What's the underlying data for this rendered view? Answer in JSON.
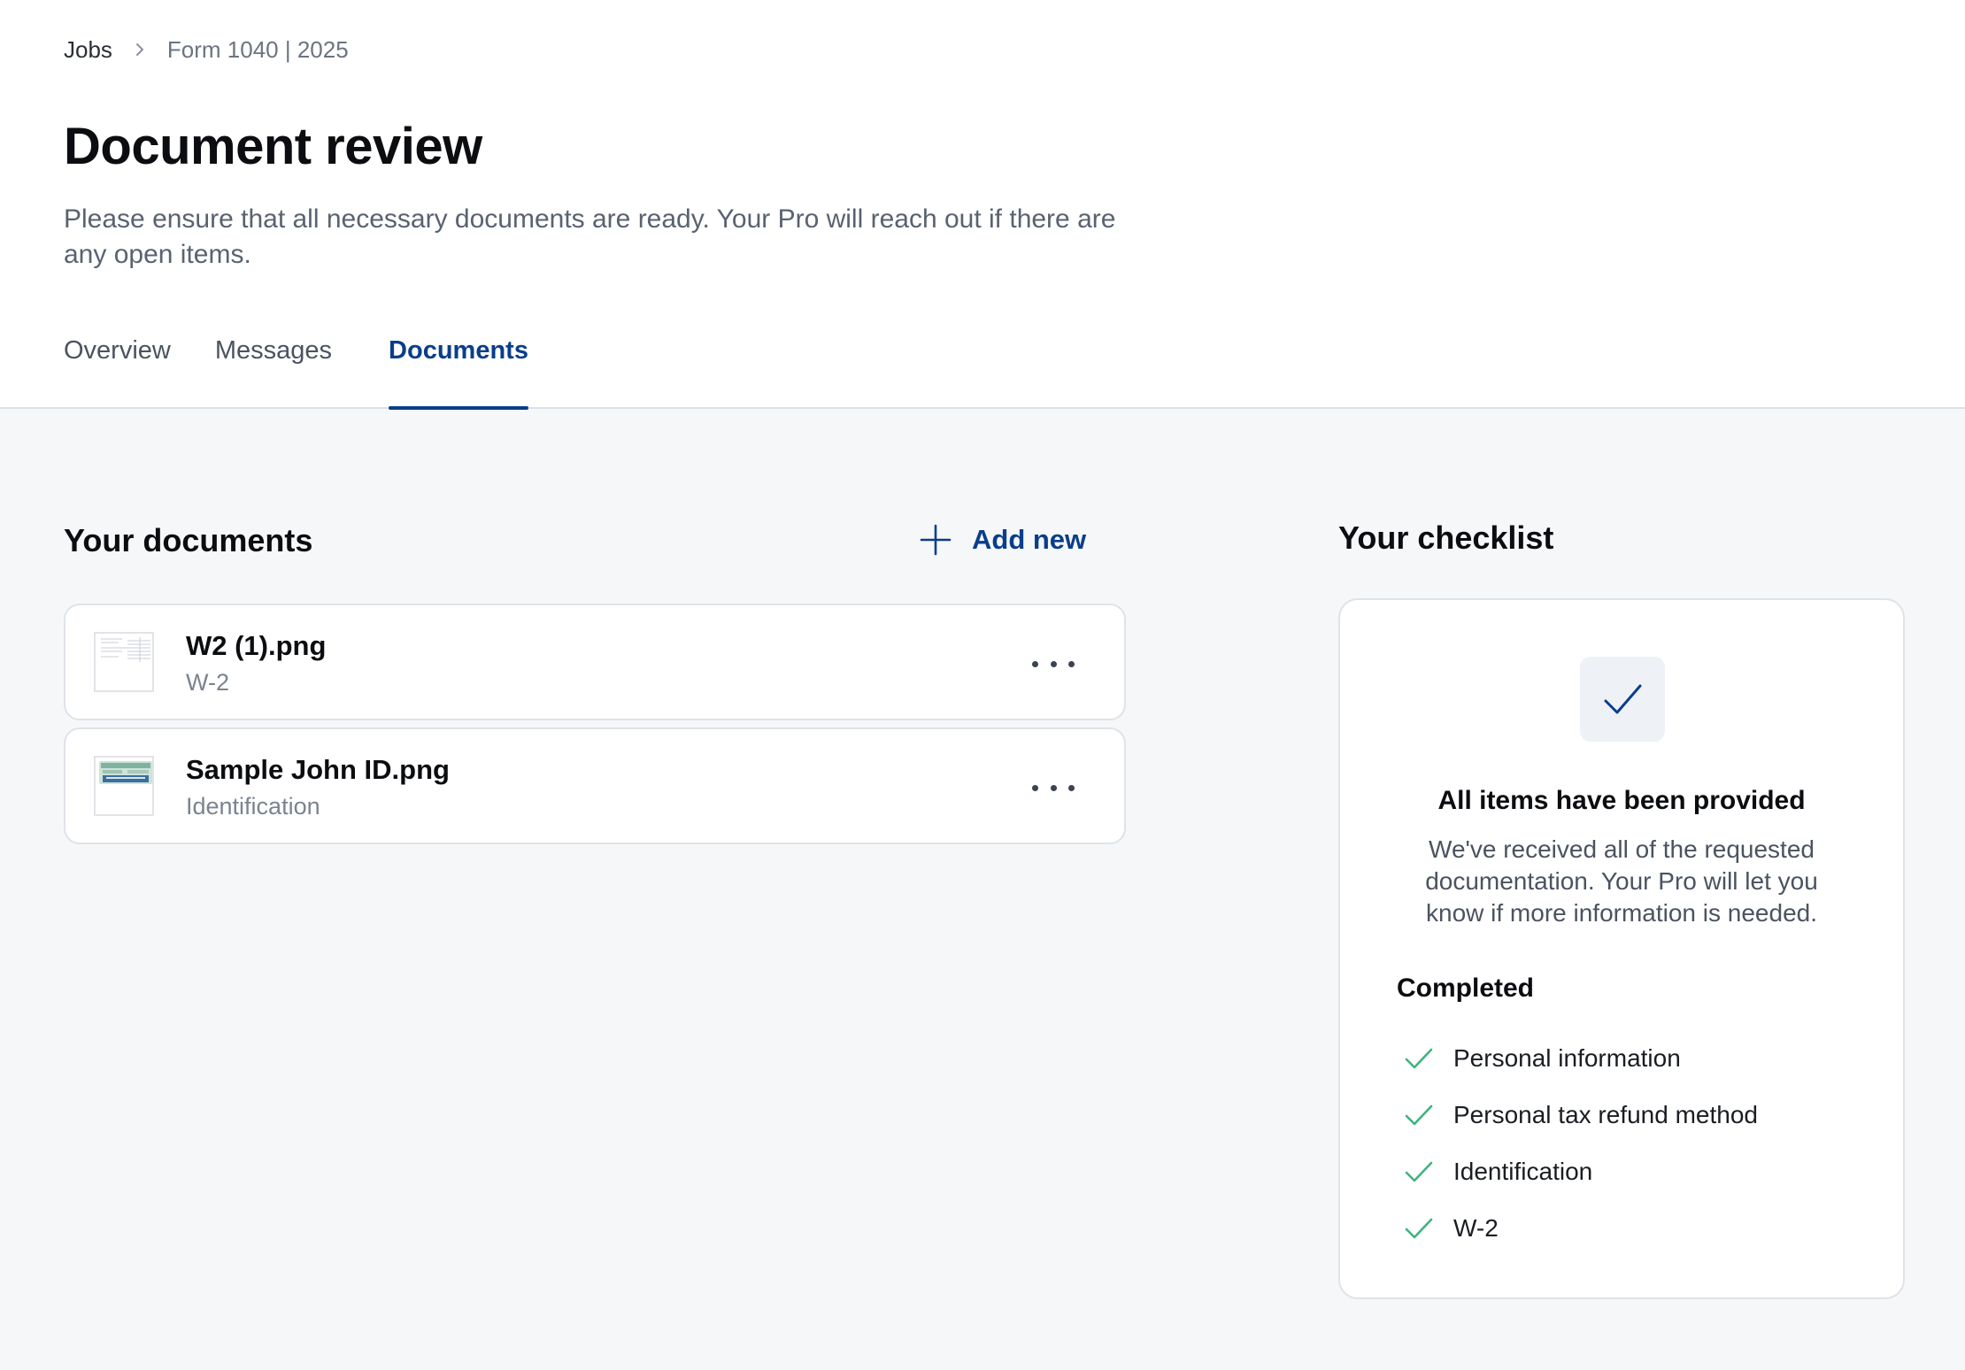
{
  "breadcrumb": {
    "root": "Jobs",
    "current": "Form 1040 | 2025"
  },
  "page": {
    "title": "Document review",
    "description": "Please ensure that all necessary documents are ready. Your Pro will reach out if there are any open items."
  },
  "tabs": [
    {
      "label": "Overview",
      "active": false
    },
    {
      "label": "Messages",
      "active": false
    },
    {
      "label": "Documents",
      "active": true
    }
  ],
  "documents": {
    "title": "Your documents",
    "add_label": "Add new",
    "items": [
      {
        "name": "W2 (1).png",
        "type": "W-2",
        "thumb_icon": "w2-form-thumbnail"
      },
      {
        "name": "Sample John ID.png",
        "type": "Identification",
        "thumb_icon": "id-card-thumbnail"
      }
    ]
  },
  "checklist": {
    "title": "Your checklist",
    "heading": "All items have been provided",
    "body": "We've received all of the requested documentation. Your Pro will let you know if more information is needed.",
    "completed_label": "Completed",
    "items": [
      "Personal information",
      "Personal tax refund method",
      "Identification",
      "W-2"
    ]
  },
  "colors": {
    "accent": "#0a3e8a",
    "check_green": "#3fb37f",
    "background": "#f6f7f9"
  }
}
